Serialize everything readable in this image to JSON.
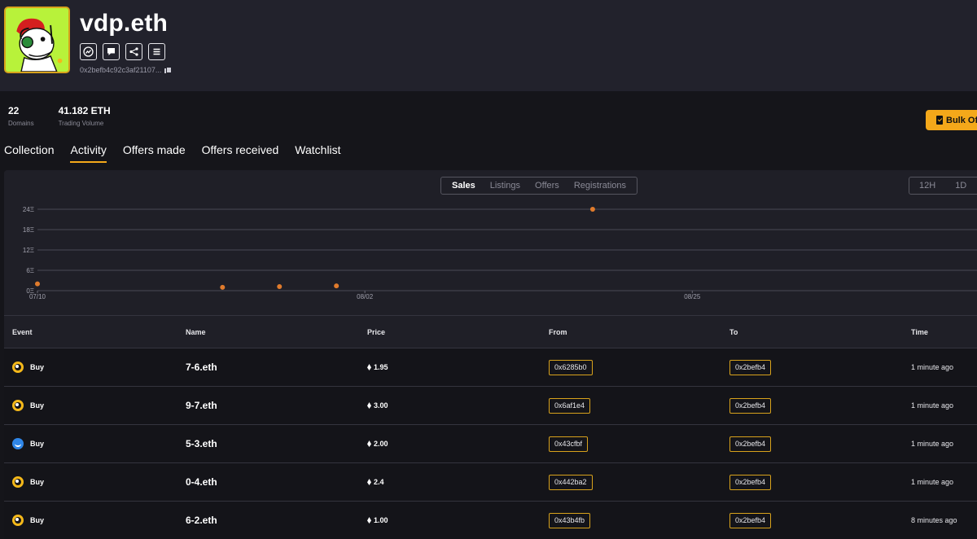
{
  "profile": {
    "name": "vdp.eth",
    "address": "0x2befb4c92c3af21107...",
    "actions": [
      "analytics-icon",
      "message-icon",
      "share-icon",
      "menu-icon"
    ]
  },
  "stats": [
    {
      "value": "22",
      "label": "Domains"
    },
    {
      "value": "41.182 ETH",
      "label": "Trading Volume"
    }
  ],
  "bulk_button": {
    "label": "Bulk Of"
  },
  "tabs": [
    {
      "label": "Collection",
      "active": false
    },
    {
      "label": "Activity",
      "active": true
    },
    {
      "label": "Offers made",
      "active": false
    },
    {
      "label": "Offers received",
      "active": false
    },
    {
      "label": "Watchlist",
      "active": false
    }
  ],
  "chart_filters": {
    "types": [
      "Sales",
      "Listings",
      "Offers",
      "Registrations"
    ],
    "active": "Sales",
    "ranges": [
      "12H",
      "1D"
    ]
  },
  "chart_data": {
    "type": "scatter",
    "x_ticks": [
      "07/10",
      "08/02",
      "08/25"
    ],
    "y_ticks": [
      "0Ξ",
      "6Ξ",
      "12Ξ",
      "18Ξ",
      "24Ξ"
    ],
    "ylim": [
      0,
      24
    ],
    "xlim": [
      "07/10",
      "09/14"
    ],
    "grid": true,
    "points": [
      {
        "x": "07/10",
        "y": 2.0
      },
      {
        "x": "07/23",
        "y": 1.0
      },
      {
        "x": "07/27",
        "y": 1.2
      },
      {
        "x": "07/31",
        "y": 1.4
      },
      {
        "x": "08/18",
        "y": 24.0
      }
    ],
    "color": "#e07b2c"
  },
  "table": {
    "columns": [
      "Event",
      "Name",
      "Price",
      "From",
      "To",
      "Time"
    ],
    "rows": [
      {
        "event": "Buy",
        "marketplace": "yellow",
        "name": "7-6.eth",
        "price": "1.95",
        "from": "0x6285b0",
        "to": "0x2befb4",
        "time": "1 minute ago"
      },
      {
        "event": "Buy",
        "marketplace": "yellow",
        "name": "9-7.eth",
        "price": "3.00",
        "from": "0x6af1e4",
        "to": "0x2befb4",
        "time": "1 minute ago"
      },
      {
        "event": "Buy",
        "marketplace": "blue",
        "name": "5-3.eth",
        "price": "2.00",
        "from": "0x43cfbf",
        "to": "0x2befb4",
        "time": "1 minute ago"
      },
      {
        "event": "Buy",
        "marketplace": "yellow",
        "name": "0-4.eth",
        "price": "2.4",
        "from": "0x442ba2",
        "to": "0x2befb4",
        "time": "1 minute ago"
      },
      {
        "event": "Buy",
        "marketplace": "yellow",
        "name": "6-2.eth",
        "price": "1.00",
        "from": "0x43b4fb",
        "to": "0x2befb4",
        "time": "8 minutes ago"
      }
    ]
  },
  "colors": {
    "accent": "#f4a81a",
    "background": "#15151a",
    "panel": "#1f1f27"
  }
}
